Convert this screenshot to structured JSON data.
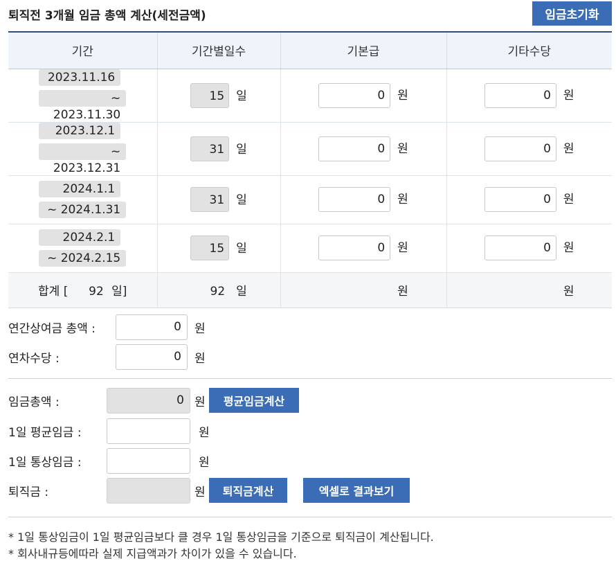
{
  "header": {
    "title": "퇴직전 3개월 임금 총액 계산(세전금액)",
    "reset_label": "임금초기화"
  },
  "table": {
    "columns": [
      "기간",
      "기간별일수",
      "기본급",
      "기타수당"
    ],
    "rows": [
      {
        "from": "2023.11.16",
        "to": "~ 2023.11.30",
        "days": "15",
        "base": "0",
        "other": "0"
      },
      {
        "from": "2023.12.1",
        "to": "~ 2023.12.31",
        "days": "31",
        "base": "0",
        "other": "0"
      },
      {
        "from": "2024.1.1",
        "to": "~ 2024.1.31",
        "days": "31",
        "base": "0",
        "other": "0"
      },
      {
        "from": "2024.2.1",
        "to": "~ 2024.2.15",
        "days": "15",
        "base": "0",
        "other": "0"
      }
    ],
    "sum": {
      "label": "합계 [",
      "days": "92",
      "close": "일]",
      "total_days": "92"
    },
    "day_unit": "일",
    "won_unit": "원"
  },
  "bonus": {
    "annual_label": "연간상여금 총액 :",
    "annual_value": "0",
    "leave_label": "연차수당 :",
    "leave_value": "0"
  },
  "calc": {
    "total_label": "임금총액 :",
    "total_value": "0",
    "avg_btn": "평균임금계산",
    "daily_avg_label": "1일 평균임금 :",
    "daily_avg_value": "",
    "daily_ord_label": "1일 통상임금 :",
    "daily_ord_value": "",
    "severance_label": "퇴직금 :",
    "severance_value": "",
    "severance_btn": "퇴직금계산",
    "excel_btn": "엑셀로 결과보기"
  },
  "notes": [
    "* 1일 통상임금이 1일 평균임금보다 클 경우 1일 통상임금을 기준으로 퇴직금이 계산됩니다.",
    "* 회사내규등에따라 실제 지급액과가 차이가 있을 수 있습니다."
  ]
}
